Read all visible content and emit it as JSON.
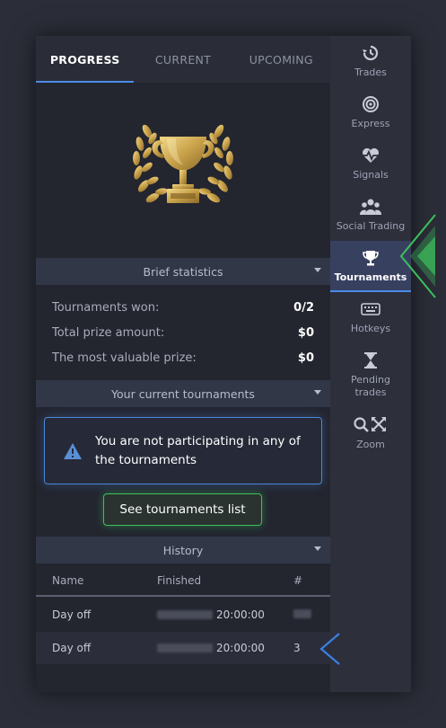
{
  "tabs": [
    {
      "label": "PROGRESS",
      "active": true
    },
    {
      "label": "CURRENT",
      "active": false
    },
    {
      "label": "UPCOMING",
      "active": false
    }
  ],
  "brief": {
    "title": "Brief statistics",
    "rows": [
      {
        "label": "Tournaments won:",
        "value": "0/2"
      },
      {
        "label": "Total prize amount:",
        "value": "$0"
      },
      {
        "label": "The most valuable prize:",
        "value": "$0"
      }
    ]
  },
  "current": {
    "title": "Your current tournaments",
    "notice": "You are not participating in any of the tournaments",
    "cta": "See tournaments list"
  },
  "history": {
    "title": "History",
    "columns": [
      "Name",
      "Finished",
      "#"
    ],
    "rows": [
      {
        "name": "Day off",
        "time": "20:00:00",
        "place": ""
      },
      {
        "name": "Day off",
        "time": "20:00:00",
        "place": "3"
      }
    ]
  },
  "sidebar": {
    "items": [
      {
        "label": "Trades",
        "icon": "history-icon"
      },
      {
        "label": "Express",
        "icon": "target-icon"
      },
      {
        "label": "Signals",
        "icon": "heart-pulse-icon"
      },
      {
        "label": "Social Trading",
        "icon": "users-icon"
      },
      {
        "label": "Tournaments",
        "icon": "trophy-icon",
        "active": true
      },
      {
        "label": "Hotkeys",
        "icon": "keyboard-icon"
      },
      {
        "label": "Pending trades",
        "icon": "hourglass-icon"
      },
      {
        "label": "Zoom",
        "icon": "zoom-icon"
      }
    ]
  },
  "colors": {
    "accent_blue": "#4a8de8",
    "accent_green": "#3cc15b",
    "gold": "#c9a24a"
  }
}
